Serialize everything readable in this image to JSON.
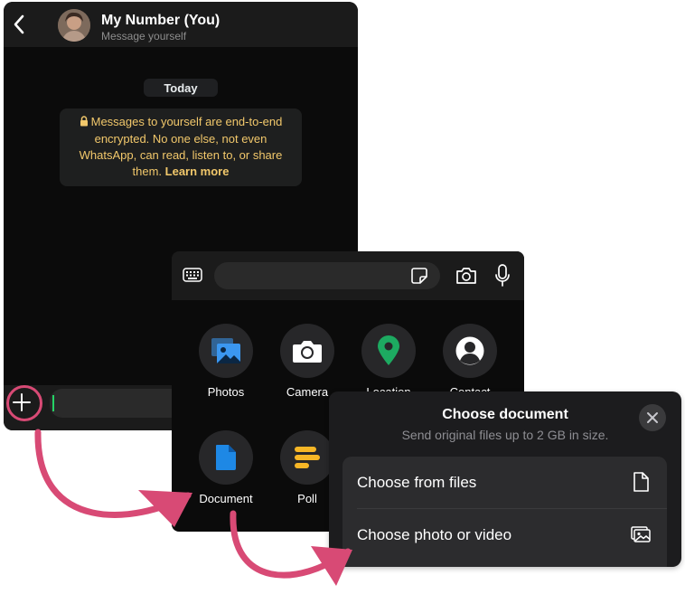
{
  "chat": {
    "title": "My Number (You)",
    "subtitle": "Message yourself",
    "date_label": "Today",
    "encryption_notice": "Messages to yourself are end-to-end encrypted. No one else, not even WhatsApp, can read, listen to, or share them.",
    "learn_more": "Learn more",
    "icons": {
      "back": "chevron-left-icon",
      "attach": "plus-icon",
      "lock": "lock-icon"
    }
  },
  "attachments": {
    "tiles": [
      {
        "label": "Photos",
        "icon": "photos-icon"
      },
      {
        "label": "Camera",
        "icon": "camera-icon"
      },
      {
        "label": "Location",
        "icon": "location-icon"
      },
      {
        "label": "Contact",
        "icon": "contact-icon"
      },
      {
        "label": "Document",
        "icon": "document-icon"
      },
      {
        "label": "Poll",
        "icon": "poll-icon"
      }
    ],
    "toolbar_icons": [
      "keyboard-icon",
      "sticker-icon",
      "camera-icon",
      "microphone-icon"
    ]
  },
  "document_sheet": {
    "title": "Choose document",
    "subtitle": "Send original files up to 2 GB in size.",
    "options": [
      {
        "label": "Choose from files",
        "icon": "file-icon"
      },
      {
        "label": "Choose photo or video",
        "icon": "gallery-icon"
      }
    ],
    "close_icon": "close-icon"
  },
  "colors": {
    "accent_green": "#25d366",
    "notice_text": "#f2c86b",
    "annotation_pink": "#d84a75",
    "photos_blue": "#3b97f0",
    "location_green": "#1daa61",
    "document_blue": "#1e88e5",
    "poll_yellow": "#f6b626"
  }
}
